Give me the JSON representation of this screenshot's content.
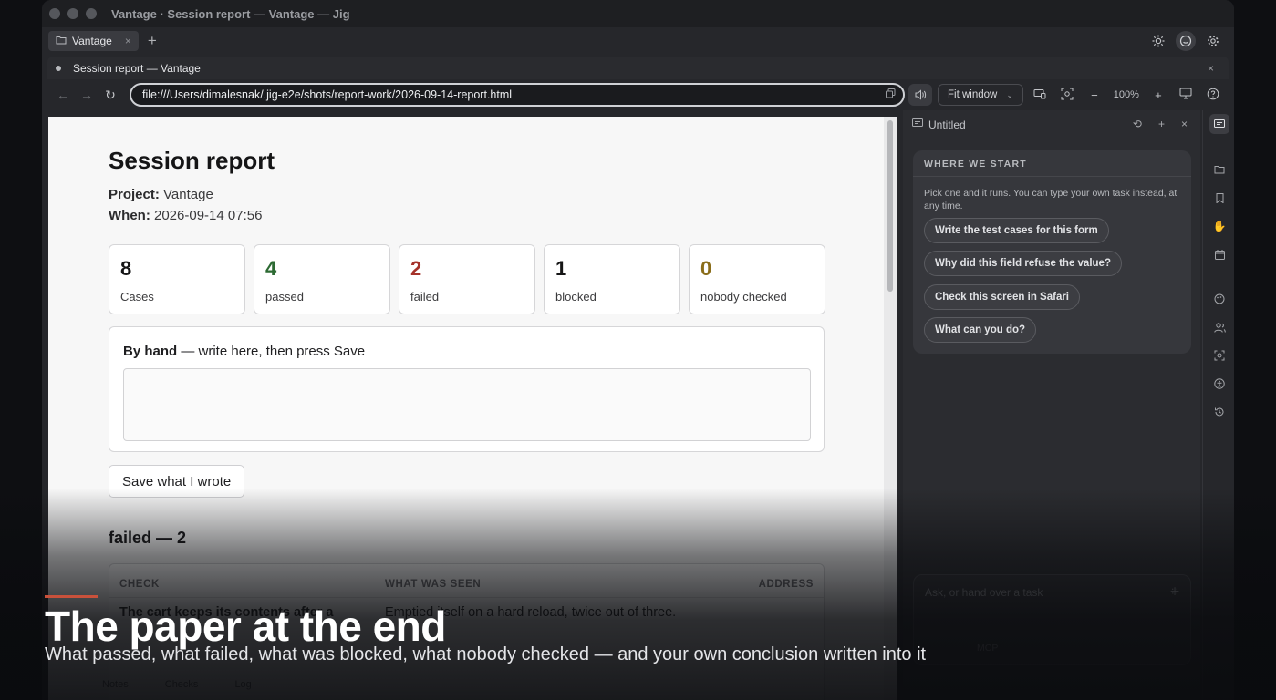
{
  "window": {
    "title": "Vantage · Session report — Vantage — Jig"
  },
  "tabs": {
    "project_tab": "Vantage",
    "close": "×",
    "new_tab": "+"
  },
  "document_tab": {
    "title": "Session report — Vantage",
    "close": "×"
  },
  "address_bar": {
    "url": "file:///Users/dimalesnak/.jig-e2e/shots/report-work/2026-09-14-report.html"
  },
  "toolbar": {
    "fit_label": "Fit window",
    "zoom_out": "−",
    "zoom_level": "100%",
    "zoom_in": "+"
  },
  "report": {
    "title": "Session report",
    "project_label": "Project:",
    "project_value": "Vantage",
    "when_label": "When:",
    "when_value": "2026-09-14 07:56",
    "stats": [
      {
        "value": "8",
        "label": "Cases"
      },
      {
        "value": "4",
        "label": "passed"
      },
      {
        "value": "2",
        "label": "failed"
      },
      {
        "value": "1",
        "label": "blocked"
      },
      {
        "value": "0",
        "label": "nobody checked"
      }
    ],
    "by_hand_title": "By hand",
    "by_hand_hint": "— write here, then press Save",
    "save_button": "Save what I wrote",
    "failed_heading": "failed — 2",
    "table": {
      "headers": [
        "CHECK",
        "WHAT WAS SEEN",
        "ADDRESS"
      ],
      "row1": {
        "check": "The cart keeps its contents after a",
        "seen": "Emptied itself on a hard reload, twice out of three."
      }
    }
  },
  "statusbar": {
    "items": [
      "Notes",
      "Checks",
      "Log"
    ]
  },
  "sidebar": {
    "title": "Untitled",
    "card_caption": "WHERE WE START",
    "card_desc": "Pick one and it runs. You can type your own task instead, at any time.",
    "suggestions": [
      "Write the test cases for this form",
      "Why did this field refuse the value?",
      "Check this screen in Safari",
      "What can you do?"
    ],
    "composer_placeholder": "Ask, or hand over a task",
    "composer_mcp": "MCP"
  },
  "overlay": {
    "title": "The paper at the end",
    "subtitle": "What passed, what failed, what was blocked, what nobody checked — and your own conclusion written into it"
  },
  "colors": {
    "accent": "#c9513b",
    "passed": "#2d6a33",
    "failed": "#a5322a",
    "nobody": "#8a6d1a"
  }
}
